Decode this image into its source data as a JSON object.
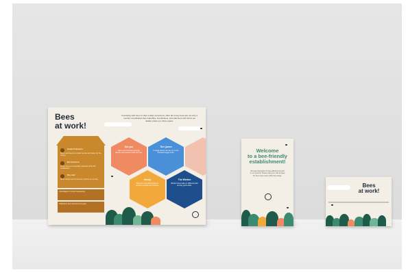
{
  "scene": {
    "wall_color": "#e2e2e2",
    "floor_color": "#ececec"
  },
  "big_poster": {
    "title_line1": "Bees",
    "title_line2": "at work!",
    "intro": "Coexisting with bees is often a daily occurrence. After all, honey bees are not only a number of pollinators like butterflies, bumblebees, and wild bees with whom we reliably share our urban space.",
    "hive_rows": [
      {
        "heading": "Garden Pollinators",
        "text": "Bees visit flowers to collect nectar and pollen for the colony."
      },
      {
        "heading": "Bee behaviour",
        "text": "Honey bees are generally peaceful when left undisturbed."
      },
      {
        "heading": "Stay calm",
        "text": "Move slowly and let the bee continue on its way."
      }
    ],
    "box_strips": [
      "Advantages of urban beekeeping",
      "Pollinators and natural food supply"
    ],
    "hexes": [
      {
        "heading": "Did you",
        "text": "Bees communicate through dances and scents inside the hive.",
        "color": "#ef8a62"
      },
      {
        "heading": "The Queen",
        "text": "A single queen can lay up to two thousand eggs a day.",
        "color": "#4a90d9"
      },
      {
        "heading": "Honey",
        "text": "Bees fly many kilometres to produce a single jar of honey.",
        "color": "#f2a93b"
      },
      {
        "heading": "The Worker",
        "text": "Worker bees take on different jobs as they grow older.",
        "color": "#1f4e8c"
      }
    ],
    "colors": {
      "hive": "#c9882b",
      "title": "#1f2b3a",
      "plants_dark": "#1f5a4a",
      "plants_mid": "#3c8a6f"
    }
  },
  "card": {
    "title_line1": "Welcome",
    "title_line2": "to a bee-friendly",
    "title_line3": "establishment!",
    "text": "We keep thousands of busy pollinators at work on our grounds. Please enjoy your visit and give the bees some space while they forage.",
    "title_color": "#3c8a6f"
  },
  "small_poster": {
    "title_line1": "Bees",
    "title_line2": "at work!"
  }
}
